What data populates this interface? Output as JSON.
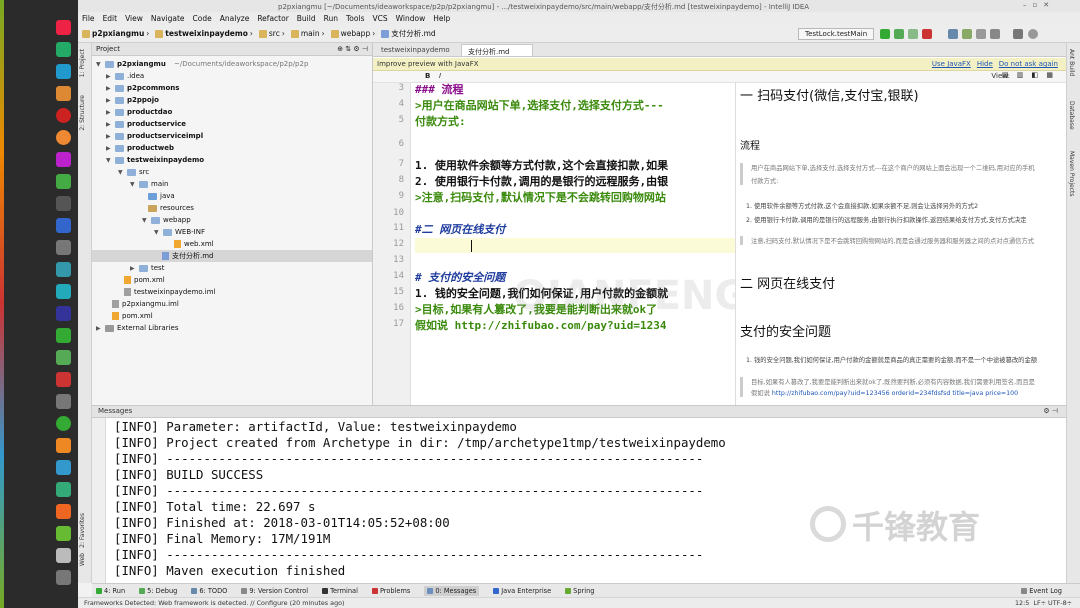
{
  "window_title": "p2pxiangmu [~/Documents/ideaworkspace/p2p/p2pxiangmu] - .../testweixinpaydemo/src/main/webapp/支付分析.md [testweixinpaydemo] - IntelliJ IDEA",
  "menu": [
    "File",
    "Edit",
    "View",
    "Navigate",
    "Code",
    "Analyze",
    "Refactor",
    "Build",
    "Run",
    "Tools",
    "VCS",
    "Window",
    "Help"
  ],
  "breadcrumbs": [
    "p2pxiangmu",
    "testweixinpaydemo",
    "src",
    "main",
    "webapp",
    "支付分析.md"
  ],
  "run_config": "TestLock.testMain",
  "project_panel": {
    "title": "Project",
    "root_path": "~/Documents/ideaworkspace/p2p/p2p",
    "tree": [
      {
        "label": "p2pxiangmu",
        "kind": "folder",
        "expanded": true
      },
      {
        "label": ".idea",
        "kind": "folder",
        "expanded": false
      },
      {
        "label": "p2pcommons",
        "kind": "folder",
        "expanded": false
      },
      {
        "label": "p2ppojo",
        "kind": "folder",
        "expanded": false
      },
      {
        "label": "productdao",
        "kind": "folder",
        "expanded": false
      },
      {
        "label": "productservice",
        "kind": "folder",
        "expanded": false
      },
      {
        "label": "productserviceimpl",
        "kind": "folder",
        "expanded": false
      },
      {
        "label": "productweb",
        "kind": "folder",
        "expanded": false
      },
      {
        "label": "testweixinpaydemo",
        "kind": "folder",
        "expanded": true
      },
      {
        "label": "src",
        "kind": "folder",
        "expanded": true
      },
      {
        "label": "main",
        "kind": "folder",
        "expanded": true
      },
      {
        "label": "java",
        "kind": "src"
      },
      {
        "label": "resources",
        "kind": "res"
      },
      {
        "label": "webapp",
        "kind": "folder",
        "expanded": true
      },
      {
        "label": "WEB-INF",
        "kind": "folder",
        "expanded": true
      },
      {
        "label": "web.xml",
        "kind": "xml"
      },
      {
        "label": "支付分析.md",
        "kind": "md",
        "selected": true
      },
      {
        "label": "test",
        "kind": "folder",
        "expanded": false
      },
      {
        "label": "pom.xml",
        "kind": "xml"
      },
      {
        "label": "testweixinpaydemo.iml",
        "kind": "iml"
      },
      {
        "label": "p2pxiangmu.iml",
        "kind": "iml"
      },
      {
        "label": "pom.xml",
        "kind": "xml"
      },
      {
        "label": "External Libraries",
        "kind": "lib"
      }
    ]
  },
  "editor": {
    "tabs": [
      "testweixinpaydemo",
      "支付分析.md"
    ],
    "notice": "Improve preview with JavaFX",
    "notice_links": [
      "Use JavaFX",
      "Hide",
      "Do not ask again"
    ],
    "view_label": "View:",
    "line_numbers": [
      "3",
      "4",
      "5",
      "6",
      "7",
      "8",
      "9",
      "10",
      "11",
      "12",
      "13",
      "14",
      "15",
      "16",
      "17"
    ],
    "lines": [
      {
        "n": "3",
        "text": "  ### 流程",
        "color": "#8a0f8a"
      },
      {
        "n": "4",
        "text": "  >用户在商品网站下单,选择支付,选择支付方式---",
        "color": "#3a8a0c"
      },
      {
        "n": "5",
        "text": "  付款方式:",
        "color": "#3a8a0c"
      },
      {
        "n": "6",
        "text": "",
        "color": "#111"
      },
      {
        "n": "7",
        "text": "    1. 使用软件余额等方式付款,这个会直接扣款,如果",
        "color": "#111"
      },
      {
        "n": "8",
        "text": "    2. 使用银行卡付款,调用的是银行的远程服务,由银",
        "color": "#111"
      },
      {
        "n": "9",
        "text": "  >注意,扫码支付,默认情况下是不会跳转回购物网站",
        "color": "#3a8a0c"
      },
      {
        "n": "10",
        "text": "",
        "color": "#111"
      },
      {
        "n": "11",
        "text": "#二 网页在线支付",
        "color": "#1f3c9e"
      },
      {
        "n": "12",
        "text": "",
        "color": "#111"
      },
      {
        "n": "13",
        "text": "",
        "color": "#111"
      },
      {
        "n": "14",
        "text": "# 支付的安全问题",
        "color": "#1f3c9e"
      },
      {
        "n": "15",
        "text": "    1. 钱的安全问题,我们如何保证,用户付款的金额就",
        "color": "#111"
      },
      {
        "n": "16",
        "text": "  >目标,如果有人篡改了,我要是能判断出来就ok了",
        "color": "#3a8a0c"
      },
      {
        "n": "17",
        "text": "  假如说 http://zhifubao.com/pay?uid=1234",
        "color": "#3a8a0c"
      }
    ]
  },
  "preview": {
    "h1_top": "一 扫码支付(微信,支付宝,银联)",
    "h3_flow": "流程",
    "quote1": "用户在商品网站下单,选择支付,选择支付方式---在这个商户的网站上面会出现一个二维码,用对应的手机",
    "quote1b": "付款方式:",
    "item1": "1. 使用软件余额等方式付款,这个会直接扣款,如果余额不足,则会让选择另外的方式2",
    "item2": "2. 使用银行卡付款,调用的是银行的远程服务,由银行执行扣款操作,返回结果给支付方式,支付方式决定",
    "quote2": "注意,扫码支付,默认情况下是不会跳转回购物网站的,而是会通过服务器和服务器之间的点对点通信方式",
    "h1_web": "二 网页在线支付",
    "h1_security": "支付的安全问题",
    "item3": "1. 钱的安全问题,我们如何保证,用户付款的金额就是商品的真正需要的金额,而不是一个中途被篡改的金额",
    "quote3": "目标,如果有人篡改了,我要是能判断出来就ok了,既然要判断,必须有内容数据,我们需要利用签名,而且是",
    "quote3_link_prefix": "假如说 ",
    "quote3_link": "http://zhifubao.com/pay?uid=123456 orderid=234fdsfsd title=java price=100"
  },
  "messages": {
    "title": "Messages",
    "lines": [
      "[INFO] Parameter: artifactId, Value: testweixinpaydemo",
      "[INFO] Project created from Archetype in dir: /tmp/archetype1tmp/testweixinpaydemo",
      "[INFO] ------------------------------------------------------------------------",
      "[INFO] BUILD SUCCESS",
      "[INFO] ------------------------------------------------------------------------",
      "[INFO] Total time: 22.697 s",
      "[INFO] Finished at: 2018-03-01T14:05:52+08:00",
      "[INFO] Final Memory: 17M/191M",
      "[INFO] ------------------------------------------------------------------------",
      "[INFO] Maven execution finished"
    ]
  },
  "bottom_tools": [
    "4: Run",
    "5: Debug",
    "6: TODO",
    "9: Version Control",
    "Terminal",
    "Problems",
    "0: Messages",
    "Java Enterprise",
    "Spring"
  ],
  "event_log": "Event Log",
  "left_stripe": [
    "1: Project",
    "2: Structure",
    "2: Favorites",
    "Web"
  ],
  "right_stripe": [
    "Ant Build",
    "Database",
    "Maven Projects"
  ],
  "status": {
    "message": "Frameworks Detected: Web framework is detected. // Configure (20 minutes ago)",
    "position": "12:5",
    "encoding": "LF÷  UTF-8÷"
  },
  "watermark": "千锋教育",
  "watermark_ghost": "QIANFENG COLLEGE",
  "colors": {
    "accent": "#1e56b8",
    "ok_green": "#3a8a0c",
    "heading_blue": "#1f3c9e",
    "heading_purple": "#8a0f8a"
  }
}
